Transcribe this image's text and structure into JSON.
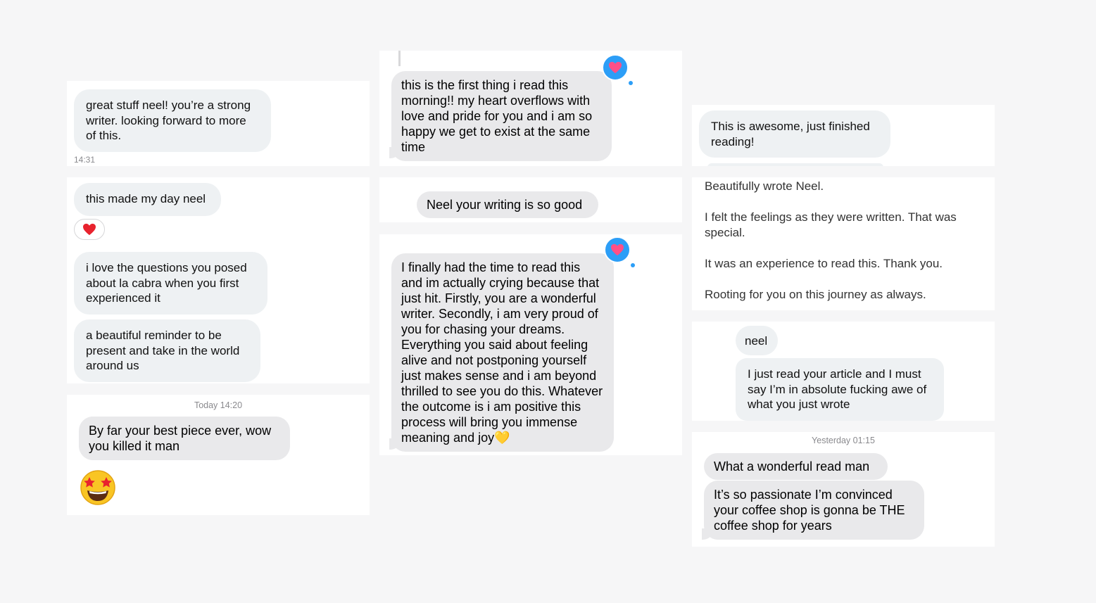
{
  "cards": {
    "c1": {
      "message": "great stuff neel! you’re a strong writer. looking forward to more of this.",
      "time": "14:31"
    },
    "c2": {
      "message1": "this made my day neel",
      "reaction": "heart",
      "message2": "i love the questions you posed about la cabra when you first experienced it",
      "message3": "a beautiful reminder to be present and take in the world around us"
    },
    "c3": {
      "timestamp": "Today 14:20",
      "message": "By far your best piece ever, wow you killed it man",
      "emoji": "star-struck"
    },
    "c4": {
      "message": "this is the first thing i read this morning!! my heart overflows with love and pride for you and i am so happy we get to exist at the same time",
      "reaction": "heart"
    },
    "c5": {
      "message": "Neel your writing is so good"
    },
    "c6": {
      "message": "I finally had the time to read this and im actually crying because that just hit. Firstly, you are a wonderful writer. Secondly, i am very proud of you for chasing your dreams. Everything you said about feeling alive and not postponing yourself just makes sense and i am beyond thrilled to see you do this. Whatever the outcome is i am positive this process will bring you immense meaning and joy💛",
      "reaction": "heart"
    },
    "c7": {
      "message": "This is awesome, just finished reading!"
    },
    "c8": {
      "line1": "Beautifully wrote Neel.",
      "line2": "I felt the feelings as they were written. That was special.",
      "line3": "It was an experience to read this. Thank you.",
      "line4": "Rooting for you on this journey as always."
    },
    "c9": {
      "message1": "neel",
      "message2": "I just read your article and I must say I’m in absolute fucking awe of what you just wrote"
    },
    "c10": {
      "timestamp": "Yesterday 01:15",
      "message1": "What a wonderful read man",
      "message2": "It’s so passionate I’m convinced your coffee shop is gonna be THE coffee shop for years"
    }
  },
  "colors": {
    "background": "#f6f6f7",
    "card": "#ffffff",
    "bubble_light": "#eef1f3",
    "bubble_imessage": "#e9e9eb",
    "reaction_blue": "#2c9ef7",
    "heart_pink": "#ff4f87"
  }
}
